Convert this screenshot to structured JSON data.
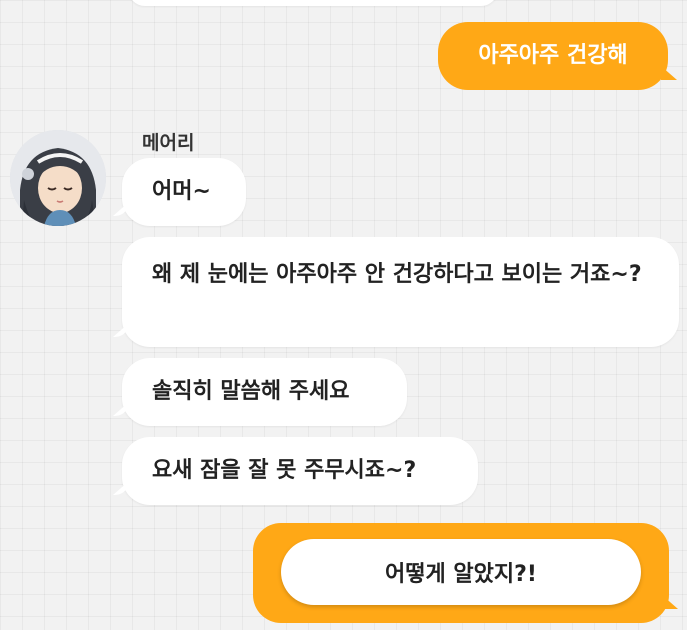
{
  "chat": {
    "sender_name": "메어리",
    "messages": {
      "out_1": "아주아주 건강해",
      "in_1": "어머~",
      "in_2": "왜 제 눈에는 아주아주 안 건강하다고 보이는 거죠~?",
      "in_3": "솔직히 말씀해 주세요",
      "in_4": "요새 잠을 잘 못 주무시죠~?"
    },
    "reply_option": "어떻게 알았지?!"
  },
  "colors": {
    "accent": "#ffa816",
    "incoming_bubble": "#ffffff",
    "background": "#f2f2f2"
  }
}
